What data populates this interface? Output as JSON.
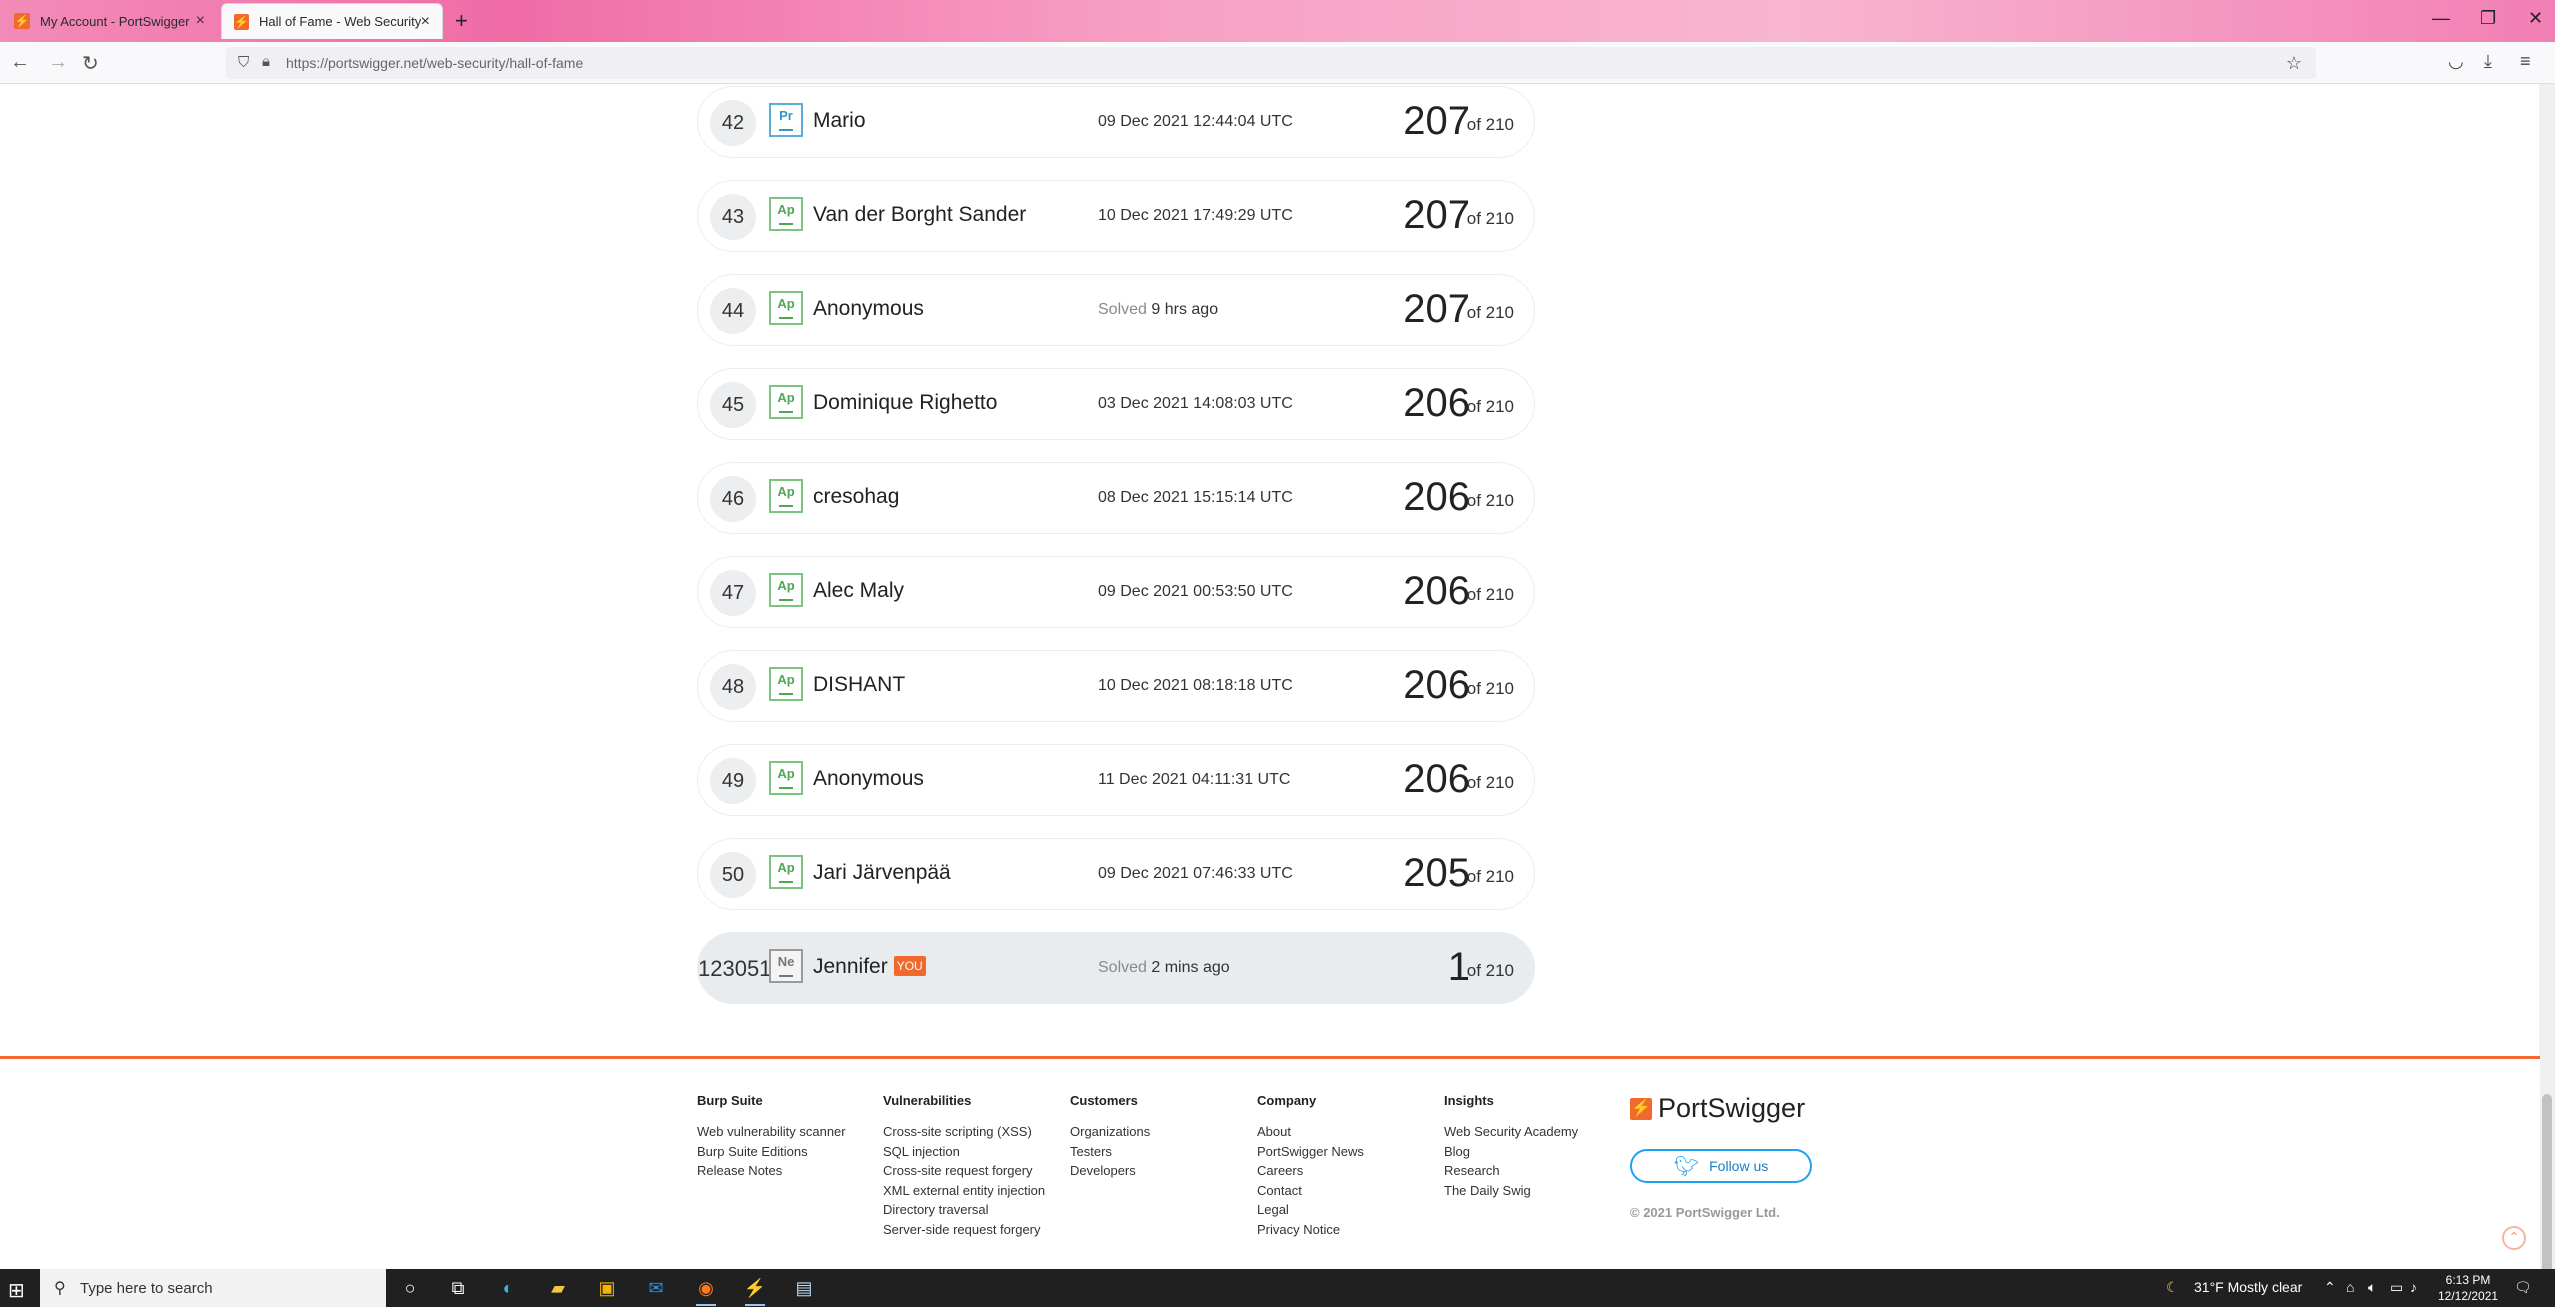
{
  "browser": {
    "tabs": [
      {
        "title": "My Account - PortSwigger",
        "active": false
      },
      {
        "title": "Hall of Fame - Web Security Ac",
        "active": true
      }
    ],
    "url_host": "https://portswigger.net",
    "url_path": "/web-security/hall-of-fame"
  },
  "leaderboard": {
    "max_label": "of 210",
    "rows": [
      {
        "rank": "42",
        "level": "Pr",
        "name": "Mario",
        "solved_prefix": "",
        "solved": "09 Dec 2021 12:44:04 UTC",
        "score": "207"
      },
      {
        "rank": "43",
        "level": "Ap",
        "name": "Van der Borght Sander",
        "solved_prefix": "",
        "solved": "10 Dec 2021 17:49:29 UTC",
        "score": "207"
      },
      {
        "rank": "44",
        "level": "Ap",
        "name": "Anonymous",
        "solved_prefix": "Solved",
        "solved": "9 hrs ago",
        "score": "207"
      },
      {
        "rank": "45",
        "level": "Ap",
        "name": "Dominique Righetto",
        "solved_prefix": "",
        "solved": "03 Dec 2021 14:08:03 UTC",
        "score": "206"
      },
      {
        "rank": "46",
        "level": "Ap",
        "name": "cresohag",
        "solved_prefix": "",
        "solved": "08 Dec 2021 15:15:14 UTC",
        "score": "206"
      },
      {
        "rank": "47",
        "level": "Ap",
        "name": "Alec Maly",
        "solved_prefix": "",
        "solved": "09 Dec 2021 00:53:50 UTC",
        "score": "206"
      },
      {
        "rank": "48",
        "level": "Ap",
        "name": "DISHANT",
        "solved_prefix": "",
        "solved": "10 Dec 2021 08:18:18 UTC",
        "score": "206"
      },
      {
        "rank": "49",
        "level": "Ap",
        "name": "Anonymous",
        "solved_prefix": "",
        "solved": "11 Dec 2021 04:11:31 UTC",
        "score": "206"
      },
      {
        "rank": "50",
        "level": "Ap",
        "name": "Jari Järvenpää",
        "solved_prefix": "",
        "solved": "09 Dec 2021 07:46:33 UTC",
        "score": "205"
      }
    ],
    "you": {
      "rank": "123051",
      "level": "Ne",
      "name": "Jennifer",
      "badge": "YOU",
      "solved_prefix": "Solved",
      "solved": "2 mins ago",
      "score": "1"
    }
  },
  "footer": {
    "columns": [
      {
        "heading": "Burp Suite",
        "links": [
          "Web vulnerability scanner",
          "Burp Suite Editions",
          "Release Notes"
        ]
      },
      {
        "heading": "Vulnerabilities",
        "links": [
          "Cross-site scripting (XSS)",
          "SQL injection",
          "Cross-site request forgery",
          "XML external entity injection",
          "Directory traversal",
          "Server-side request forgery"
        ]
      },
      {
        "heading": "Customers",
        "links": [
          "Organizations",
          "Testers",
          "Developers"
        ]
      },
      {
        "heading": "Company",
        "links": [
          "About",
          "PortSwigger News",
          "Careers",
          "Contact",
          "Legal",
          "Privacy Notice"
        ]
      },
      {
        "heading": "Insights",
        "links": [
          "Web Security Academy",
          "Blog",
          "Research",
          "The Daily Swig"
        ]
      }
    ],
    "brand": "PortSwigger",
    "follow_label": "Follow us",
    "copyright": "© 2021 PortSwigger Ltd."
  },
  "taskbar": {
    "search_placeholder": "Type here to search",
    "weather": "31°F  Mostly clear",
    "time": "6:13 PM",
    "date": "12/12/2021"
  },
  "colors": {
    "brand_orange": "#f06a2e",
    "twitter_blue": "#1da1f2",
    "level_green": "#7bc47f"
  }
}
